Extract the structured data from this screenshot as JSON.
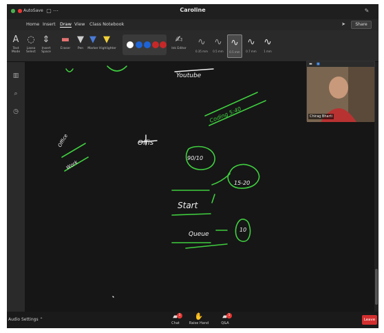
{
  "window": {
    "title": "Caroline",
    "autosave_label": "AutoSave",
    "autosave_state": "On"
  },
  "menu": {
    "tabs": [
      "Home",
      "Insert",
      "Draw",
      "View",
      "Class Notebook"
    ],
    "active_tab": "Draw",
    "share_label": "Share"
  },
  "ribbon": {
    "tools": [
      {
        "label": "Text Mode",
        "icon": "text-mode-icon"
      },
      {
        "label": "Lasso Select",
        "icon": "lasso-icon"
      },
      {
        "label": "Insert Space",
        "icon": "insert-space-icon"
      },
      {
        "label": "Eraser",
        "icon": "eraser-icon"
      },
      {
        "label": "Pen",
        "icon": "pen-icon"
      },
      {
        "label": "Marker",
        "icon": "marker-icon"
      },
      {
        "label": "Highlighter",
        "icon": "highlighter-icon"
      }
    ],
    "colors": [
      "#ffffff",
      "#1e63d6",
      "#1e63d6",
      "#c62828",
      "#c62828"
    ],
    "ink_to_shape": "Ink Editor",
    "pen_sizes": [
      "0.35 mm",
      "0.5 mm",
      "0.5 mm",
      "0.7 mm",
      "1 mm"
    ]
  },
  "canvas": {
    "notes": [
      "Youtube",
      "Coding 5:40",
      "Office",
      "Offis",
      "Work",
      "90/10",
      "15-20",
      "Start",
      "Queue",
      "10"
    ]
  },
  "video": {
    "name": "Chirag Bharti"
  },
  "bottombar": {
    "audio_label": "Audio Settings",
    "chat_label": "Chat",
    "chat_count": "1",
    "raise_hand_label": "Raise Hand",
    "qa_label": "Q&A",
    "qa_count": "1",
    "leave_label": "Leave"
  },
  "colors": {
    "ink": "#3fcf3f",
    "ink_white": "#f2f2f2",
    "leave": "#d32f2f"
  }
}
